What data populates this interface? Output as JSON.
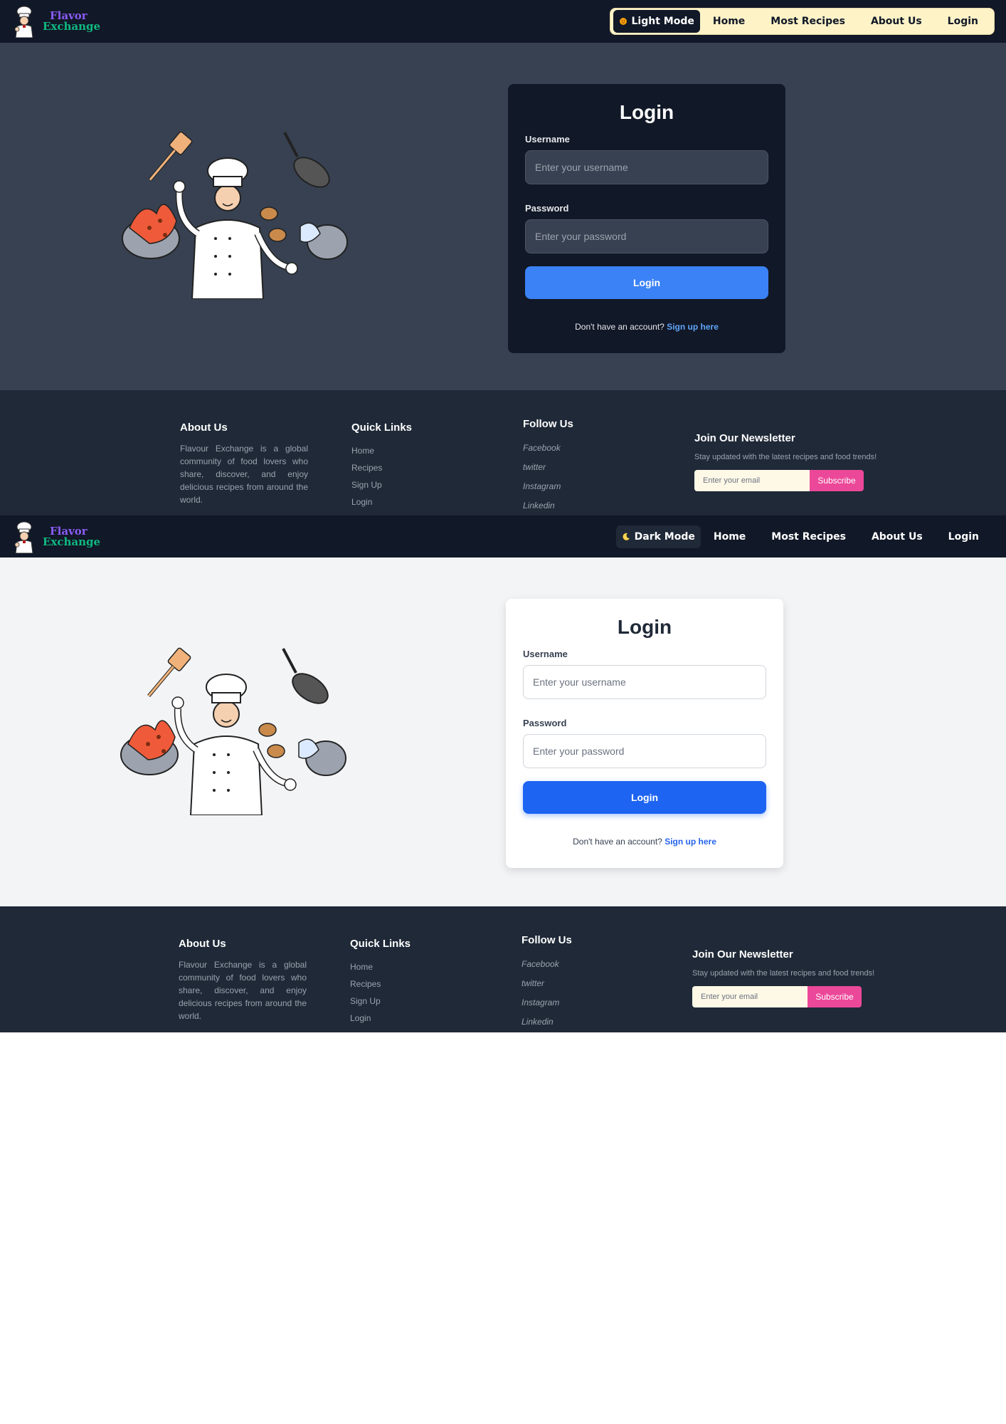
{
  "brand": {
    "line1": "Flavor",
    "line2": "Exchange"
  },
  "frame1": {
    "mode_button": "Light Mode",
    "mode_icon": "sun-icon",
    "nav": [
      "Home",
      "Most Recipes",
      "About Us",
      "Login"
    ]
  },
  "frame2": {
    "mode_button": "Dark Mode",
    "mode_icon": "moon-icon",
    "nav": [
      "Home",
      "Most Recipes",
      "About Us",
      "Login"
    ]
  },
  "login": {
    "title": "Login",
    "username_label": "Username",
    "username_placeholder": "Enter your username",
    "password_label": "Password",
    "password_placeholder": "Enter your password",
    "submit": "Login",
    "signup_prompt": "Don't have an account?",
    "signup_link": "Sign up here"
  },
  "footer": {
    "about_title": "About Us",
    "about_text": "Flavour Exchange is a global community of food lovers who share, discover, and enjoy delicious recipes from around the world.",
    "quick_title": "Quick Links",
    "quick_links": [
      "Home",
      "Recipes",
      "Sign Up",
      "Login"
    ],
    "follow_title": "Follow Us",
    "follow_links": [
      "Facebook",
      "twitter",
      "Instagram",
      "Linkedin"
    ],
    "news_title": "Join Our Newsletter",
    "news_text": "Stay updated with the latest recipes and food trends!",
    "email_placeholder": "Enter your email",
    "subscribe": "Subscribe"
  },
  "colors": {
    "dark_nav": "#111827",
    "dark_hero": "#374151",
    "light_hero": "#f3f4f6",
    "footer": "#1f2937",
    "primary_button": "#3b82f6",
    "subscribe": "#ec4899",
    "brand_purple": "#8b5cf6",
    "brand_green": "#10b981"
  }
}
